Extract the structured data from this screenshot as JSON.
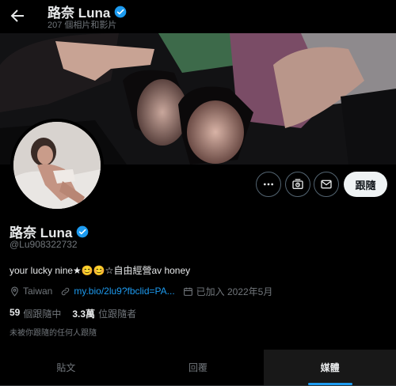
{
  "header": {
    "name": "路奈 Luna",
    "post_count": "207 個相片和影片"
  },
  "profile": {
    "name": "路奈 Luna",
    "handle": "@Lu908322732",
    "bio": "your lucky nine★😊😊☆自由經營av honey",
    "location": "Taiwan",
    "link": "my.bio/2lu9?fbclid=PA...",
    "joined": "已加入 2022年5月",
    "following_count": "59",
    "following_label": "個跟隨中",
    "followers_count": "3.3萬",
    "followers_label": "位跟隨者",
    "mutual_note": "未被你跟隨的任何人跟隨"
  },
  "actions": {
    "follow_label": "跟隨"
  },
  "tabs": [
    {
      "label": "貼文"
    },
    {
      "label": "回覆"
    },
    {
      "label": "媒體",
      "active": true
    }
  ],
  "colors": {
    "accent": "#1d9bf0",
    "verified": "#1d9bf0",
    "background": "#000000",
    "muted": "#71767b"
  },
  "icons": [
    "back-arrow-icon",
    "verified-badge-icon",
    "more-icon",
    "subscribe-icon",
    "message-icon",
    "location-icon",
    "link-icon",
    "calendar-icon"
  ]
}
